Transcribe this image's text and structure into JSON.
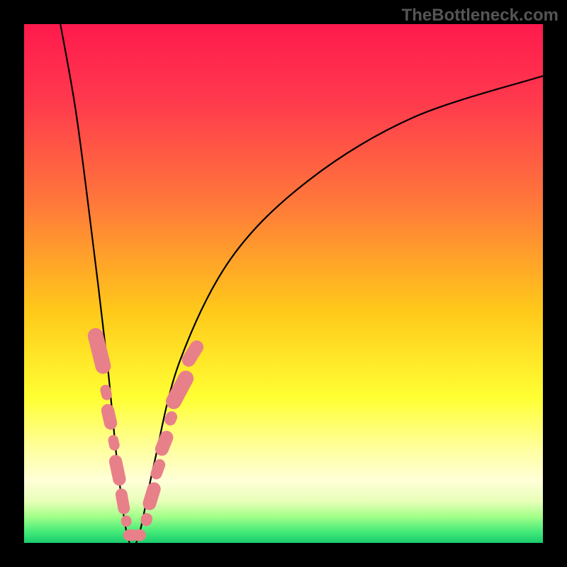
{
  "watermark": "TheBottleneck.com",
  "chart_data": {
    "type": "line",
    "title": "",
    "xlabel": "",
    "ylabel": "",
    "x_range": [
      0,
      100
    ],
    "y_range": [
      0,
      100
    ],
    "series": [
      {
        "name": "curve",
        "description": "V-shaped bottleneck curve with left steep descent and right asymptotic ascent",
        "minimum_x": 20,
        "path_points": [
          {
            "x": 7,
            "y": 100
          },
          {
            "x": 10,
            "y": 83
          },
          {
            "x": 13,
            "y": 60
          },
          {
            "x": 16,
            "y": 35
          },
          {
            "x": 18,
            "y": 15
          },
          {
            "x": 20,
            "y": 1
          },
          {
            "x": 22,
            "y": 1
          },
          {
            "x": 25,
            "y": 15
          },
          {
            "x": 30,
            "y": 35
          },
          {
            "x": 40,
            "y": 55
          },
          {
            "x": 55,
            "y": 70
          },
          {
            "x": 75,
            "y": 82
          },
          {
            "x": 100,
            "y": 90
          }
        ]
      }
    ],
    "markers": [
      {
        "x": 14.5,
        "y": 37,
        "w": 3.0,
        "h": 9,
        "angle": -14
      },
      {
        "x": 15.8,
        "y": 29,
        "w": 2.0,
        "h": 3,
        "angle": -14
      },
      {
        "x": 16.4,
        "y": 24.3,
        "w": 2.5,
        "h": 5,
        "angle": -13
      },
      {
        "x": 17.3,
        "y": 19.3,
        "w": 2.0,
        "h": 3,
        "angle": -12
      },
      {
        "x": 18.0,
        "y": 14,
        "w": 2.5,
        "h": 6,
        "angle": -12
      },
      {
        "x": 19.0,
        "y": 8,
        "w": 2.3,
        "h": 5,
        "angle": -10
      },
      {
        "x": 19.7,
        "y": 4.2,
        "w": 2.0,
        "h": 2.2,
        "angle": -8
      },
      {
        "x": 20.5,
        "y": 1.5,
        "w": 2.8,
        "h": 2.2,
        "angle": 0
      },
      {
        "x": 22.1,
        "y": 1.5,
        "w": 2.8,
        "h": 2.2,
        "angle": 0
      },
      {
        "x": 23.6,
        "y": 4.5,
        "w": 2.2,
        "h": 2.5,
        "angle": 15
      },
      {
        "x": 24.6,
        "y": 9,
        "w": 2.6,
        "h": 5.5,
        "angle": 17
      },
      {
        "x": 25.8,
        "y": 14.2,
        "w": 2.2,
        "h": 4,
        "angle": 20
      },
      {
        "x": 27.0,
        "y": 19.2,
        "w": 2.6,
        "h": 5,
        "angle": 22
      },
      {
        "x": 28.3,
        "y": 24,
        "w": 2.2,
        "h": 2.8,
        "angle": 23
      },
      {
        "x": 30.0,
        "y": 29.5,
        "w": 3.0,
        "h": 8,
        "angle": 28
      },
      {
        "x": 32.5,
        "y": 36.5,
        "w": 2.6,
        "h": 5.5,
        "angle": 32
      }
    ],
    "gradient_stops": [
      {
        "offset": 0,
        "color": "#ff1a4d"
      },
      {
        "offset": 15,
        "color": "#ff3a4d"
      },
      {
        "offset": 35,
        "color": "#ff7a3a"
      },
      {
        "offset": 55,
        "color": "#ffc81a"
      },
      {
        "offset": 72,
        "color": "#ffff33"
      },
      {
        "offset": 82,
        "color": "#ffffa0"
      },
      {
        "offset": 88,
        "color": "#ffffd8"
      },
      {
        "offset": 92,
        "color": "#e8ffb8"
      },
      {
        "offset": 95,
        "color": "#a0ff88"
      },
      {
        "offset": 98,
        "color": "#40e878"
      },
      {
        "offset": 100,
        "color": "#1acc6e"
      }
    ]
  }
}
